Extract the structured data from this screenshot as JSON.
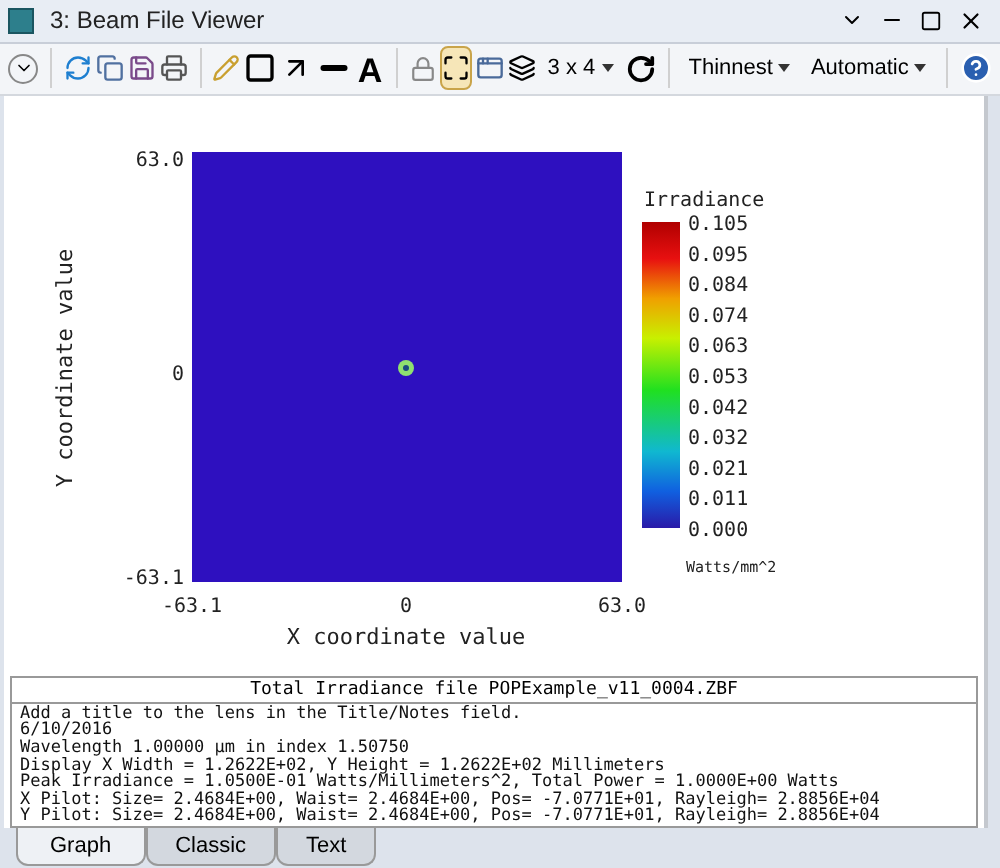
{
  "window": {
    "title": "3: Beam File Viewer"
  },
  "toolbar": {
    "text_tool": "A",
    "layout": "3 x 4",
    "line_width": "Thinnest",
    "scale": "Automatic",
    "fit_button": {
      "selected": true
    }
  },
  "plot": {
    "y_label": "Y coordinate value",
    "x_label": "X coordinate value",
    "y_ticks": [
      "63.0",
      "0",
      "-63.1"
    ],
    "x_ticks": [
      "-63.1",
      "0",
      "63.0"
    ],
    "colorbar": {
      "title": "Irradiance",
      "labels": [
        "0.105",
        "0.095",
        "0.084",
        "0.074",
        "0.063",
        "0.053",
        "0.042",
        "0.032",
        "0.021",
        "0.011",
        "0.000"
      ],
      "unit": "Watts/mm^2"
    }
  },
  "text_panel": {
    "title": "Total Irradiance file POPExample_v11_0004.ZBF",
    "lines": [
      "Add a title to the lens in the Title/Notes field.",
      "6/10/2016",
      "Wavelength 1.00000 µm in index 1.50750",
      "Display X Width = 1.2622E+02, Y Height = 1.2622E+02 Millimeters",
      "Peak Irradiance = 1.0500E-01 Watts/Millimeters^2, Total Power = 1.0000E+00 Watts",
      "X Pilot: Size= 2.4684E+00, Waist= 2.4684E+00, Pos= -7.0771E+01, Rayleigh= 2.8856E+04",
      "Y Pilot: Size= 2.4684E+00, Waist= 2.4684E+00, Pos= -7.0771E+01, Rayleigh= 2.8856E+04"
    ]
  },
  "tabs": [
    {
      "label": "Graph",
      "selected": true
    },
    {
      "label": "Classic",
      "selected": false
    },
    {
      "label": "Text",
      "selected": false
    }
  ]
}
